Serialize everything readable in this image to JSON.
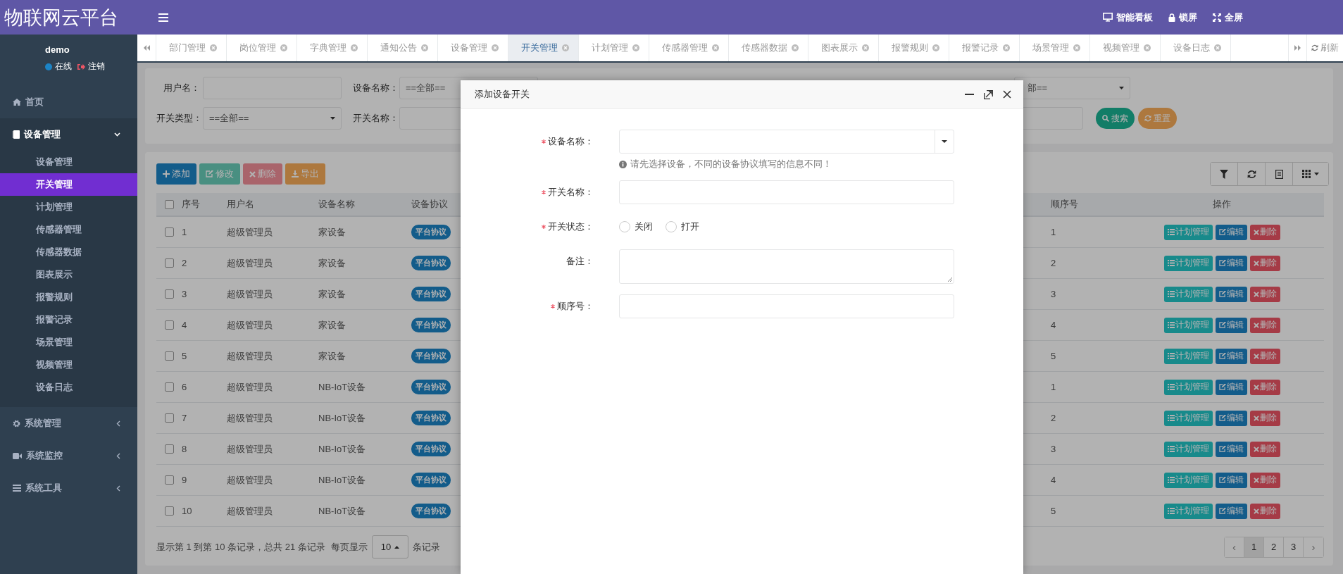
{
  "app": {
    "logo": "物联网云平台"
  },
  "top_actions": [
    {
      "label": "智能看板"
    },
    {
      "label": "锁屏"
    },
    {
      "label": "全屏"
    }
  ],
  "user": {
    "name": "demo",
    "status": "在线",
    "logout": "注销"
  },
  "sidebar": {
    "items": [
      {
        "label": "首页",
        "kind": "link"
      },
      {
        "label": "设备管理",
        "kind": "group",
        "expanded": true,
        "children": [
          {
            "label": "设备管理",
            "selected": false
          },
          {
            "label": "开关管理",
            "selected": true
          },
          {
            "label": "计划管理",
            "selected": false
          },
          {
            "label": "传感器管理",
            "selected": false
          },
          {
            "label": "传感器数据",
            "selected": false
          },
          {
            "label": "图表展示",
            "selected": false
          },
          {
            "label": "报警规则",
            "selected": false
          },
          {
            "label": "报警记录",
            "selected": false
          },
          {
            "label": "场景管理",
            "selected": false
          },
          {
            "label": "视频管理",
            "selected": false
          },
          {
            "label": "设备日志",
            "selected": false
          }
        ]
      },
      {
        "label": "系统管理",
        "kind": "group",
        "expanded": false
      },
      {
        "label": "系统监控",
        "kind": "group",
        "expanded": false
      },
      {
        "label": "系统工具",
        "kind": "group",
        "expanded": false
      }
    ]
  },
  "tabs": [
    {
      "label": "部门管理",
      "selected": false
    },
    {
      "label": "岗位管理",
      "selected": false
    },
    {
      "label": "字典管理",
      "selected": false
    },
    {
      "label": "通知公告",
      "selected": false
    },
    {
      "label": "设备管理",
      "selected": false
    },
    {
      "label": "开关管理",
      "selected": true
    },
    {
      "label": "计划管理",
      "selected": false
    },
    {
      "label": "传感器管理",
      "selected": false
    },
    {
      "label": "传感器数据",
      "selected": false
    },
    {
      "label": "图表展示",
      "selected": false
    },
    {
      "label": "报警规则",
      "selected": false
    },
    {
      "label": "报警记录",
      "selected": false
    },
    {
      "label": "场景管理",
      "selected": false
    },
    {
      "label": "视频管理",
      "selected": false
    },
    {
      "label": "设备日志",
      "selected": false
    }
  ],
  "tab_refresh": "刷新",
  "filters": {
    "rows": [
      {
        "fields": [
          {
            "label": "用户名：",
            "kind": "input"
          },
          {
            "label": "设备名称：",
            "kind": "select",
            "value": "==全部=="
          }
        ],
        "fields_after_dialog": [
          {
            "kind": "select",
            "value": "部=="
          }
        ]
      },
      {
        "fields": [
          {
            "label": "开关类型：",
            "kind": "select",
            "value": "==全部=="
          },
          {
            "label": "开关名称：",
            "kind": "input"
          }
        ],
        "fields_after_dialog": [
          {
            "kind": "input"
          }
        ]
      }
    ],
    "buttons": [
      {
        "label": "搜索",
        "kind": "search"
      },
      {
        "label": "重置",
        "kind": "reset"
      }
    ]
  },
  "toolbar": [
    {
      "label": "添加",
      "kind": "add",
      "disabled": false
    },
    {
      "label": "修改",
      "kind": "edit",
      "disabled": true
    },
    {
      "label": "删除",
      "kind": "delete",
      "disabled": true
    },
    {
      "label": "导出",
      "kind": "export",
      "disabled": false
    }
  ],
  "table": {
    "header_checked": false,
    "columns": [
      "序号",
      "用户名",
      "设备名称",
      "设备协议",
      "顺序号",
      "操作"
    ],
    "rows": [
      {
        "checked": false,
        "seq": "1",
        "user": "超级管理员",
        "device": "家设备",
        "protocol": "平台协议",
        "order": "1",
        "actions": [
          {
            "label": "计划管理",
            "kind": "plan"
          },
          {
            "label": "编辑",
            "kind": "edit"
          },
          {
            "label": "删除",
            "kind": "delete"
          }
        ]
      },
      {
        "checked": false,
        "seq": "2",
        "user": "超级管理员",
        "device": "家设备",
        "protocol": "平台协议",
        "order": "2",
        "actions": [
          {
            "label": "计划管理",
            "kind": "plan"
          },
          {
            "label": "编辑",
            "kind": "edit"
          },
          {
            "label": "删除",
            "kind": "delete"
          }
        ]
      },
      {
        "checked": false,
        "seq": "3",
        "user": "超级管理员",
        "device": "家设备",
        "protocol": "平台协议",
        "order": "3",
        "actions": [
          {
            "label": "计划管理",
            "kind": "plan"
          },
          {
            "label": "编辑",
            "kind": "edit"
          },
          {
            "label": "删除",
            "kind": "delete"
          }
        ]
      },
      {
        "checked": false,
        "seq": "4",
        "user": "超级管理员",
        "device": "家设备",
        "protocol": "平台协议",
        "order": "4",
        "actions": [
          {
            "label": "计划管理",
            "kind": "plan"
          },
          {
            "label": "编辑",
            "kind": "edit"
          },
          {
            "label": "删除",
            "kind": "delete"
          }
        ]
      },
      {
        "checked": false,
        "seq": "5",
        "user": "超级管理员",
        "device": "家设备",
        "protocol": "平台协议",
        "order": "5",
        "actions": [
          {
            "label": "计划管理",
            "kind": "plan"
          },
          {
            "label": "编辑",
            "kind": "edit"
          },
          {
            "label": "删除",
            "kind": "delete"
          }
        ]
      },
      {
        "checked": false,
        "seq": "6",
        "user": "超级管理员",
        "device": "NB-IoT设备",
        "protocol": "平台协议",
        "order": "1",
        "actions": [
          {
            "label": "计划管理",
            "kind": "plan"
          },
          {
            "label": "编辑",
            "kind": "edit"
          },
          {
            "label": "删除",
            "kind": "delete"
          }
        ]
      },
      {
        "checked": false,
        "seq": "7",
        "user": "超级管理员",
        "device": "NB-IoT设备",
        "protocol": "平台协议",
        "order": "2",
        "actions": [
          {
            "label": "计划管理",
            "kind": "plan"
          },
          {
            "label": "编辑",
            "kind": "edit"
          },
          {
            "label": "删除",
            "kind": "delete"
          }
        ]
      },
      {
        "checked": false,
        "seq": "8",
        "user": "超级管理员",
        "device": "NB-IoT设备",
        "protocol": "平台协议",
        "order": "3",
        "actions": [
          {
            "label": "计划管理",
            "kind": "plan"
          },
          {
            "label": "编辑",
            "kind": "edit"
          },
          {
            "label": "删除",
            "kind": "delete"
          }
        ]
      },
      {
        "checked": false,
        "seq": "9",
        "user": "超级管理员",
        "device": "NB-IoT设备",
        "protocol": "平台协议",
        "order": "4",
        "actions": [
          {
            "label": "计划管理",
            "kind": "plan"
          },
          {
            "label": "编辑",
            "kind": "edit"
          },
          {
            "label": "删除",
            "kind": "delete"
          }
        ]
      },
      {
        "checked": false,
        "seq": "10",
        "user": "超级管理员",
        "device": "NB-IoT设备",
        "protocol": "平台协议",
        "order": "5",
        "actions": [
          {
            "label": "计划管理",
            "kind": "plan"
          },
          {
            "label": "编辑",
            "kind": "edit"
          },
          {
            "label": "删除",
            "kind": "delete"
          }
        ]
      }
    ]
  },
  "pagination": {
    "summary": "显示第 1 到第 10 条记录，总共 21 条记录",
    "per_page_prefix": "每页显示",
    "per_page": "10",
    "per_page_suffix": "条记录",
    "pages": [
      {
        "label": "‹",
        "kind": "prev",
        "selected": false
      },
      {
        "label": "1",
        "kind": "page",
        "selected": true
      },
      {
        "label": "2",
        "kind": "page",
        "selected": false
      },
      {
        "label": "3",
        "kind": "page",
        "selected": false
      },
      {
        "label": "›",
        "kind": "next",
        "selected": false
      }
    ]
  },
  "dialog": {
    "title": "添加设备开关",
    "fields": [
      {
        "label": "设备名称：",
        "required": true,
        "kind": "select",
        "hint": "请先选择设备，不同的设备协议填写的信息不同！"
      },
      {
        "label": "开关名称：",
        "required": true,
        "kind": "input"
      },
      {
        "label": "开关状态：",
        "required": true,
        "kind": "radio",
        "options": [
          {
            "label": "关闭",
            "selected": false
          },
          {
            "label": "打开",
            "selected": false
          }
        ]
      },
      {
        "label": "备注：",
        "required": false,
        "kind": "textarea"
      },
      {
        "label": "顺序号：",
        "required": true,
        "kind": "input"
      }
    ]
  }
}
